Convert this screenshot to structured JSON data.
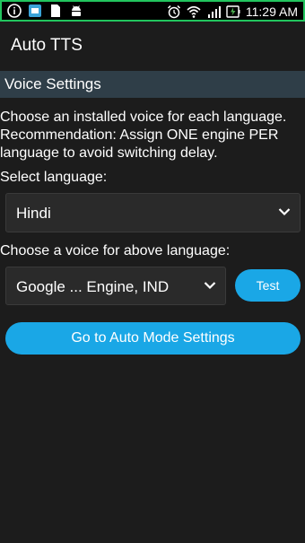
{
  "status_bar": {
    "time": "11:29 AM",
    "left_icons": [
      "info-icon",
      "screen-record-icon",
      "file-icon",
      "android-icon"
    ],
    "right_icons": [
      "alarm-icon",
      "wifi-icon",
      "signal-icon",
      "battery-charging-icon"
    ]
  },
  "app": {
    "title": "Auto TTS"
  },
  "section": {
    "header": "Voice Settings",
    "description_line1": "Choose an installed voice for each language.",
    "description_line2": "Recommendation: Assign ONE engine PER language to avoid switching delay."
  },
  "language": {
    "label": "Select language:",
    "selected": "Hindi"
  },
  "voice": {
    "label": "Choose a voice for above language:",
    "selected": "Google ... Engine, IND",
    "test_label": "Test"
  },
  "actions": {
    "auto_mode_label": "Go to Auto Mode Settings"
  },
  "colors": {
    "background": "#1c1c1c",
    "section_header": "#2f3e48",
    "accent": "#1aa7e6",
    "status_border": "#22c55e"
  }
}
